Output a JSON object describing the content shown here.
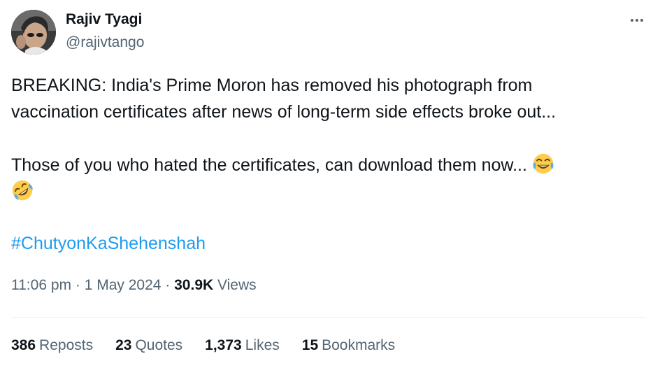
{
  "author": {
    "display_name": "Rajiv Tyagi",
    "handle": "@rajivtango"
  },
  "tweet": {
    "line1": "BREAKING: India's Prime Moron has removed his photograph from",
    "line2": "vaccination certificates after news of long-term side effects broke out...",
    "line3": "Those of you who hated the certificates, can download them now...",
    "emoji1": "face-with-tears-of-joy",
    "emoji2": "rolling-on-the-floor-laughing",
    "hashtag": "#ChutyonKaShehenshah"
  },
  "meta": {
    "time": "11:06 pm",
    "separator": "·",
    "date": "1 May 2024",
    "views_count": "30.9K",
    "views_label": "Views"
  },
  "stats": {
    "reposts_count": "386",
    "reposts_label": "Reposts",
    "quotes_count": "23",
    "quotes_label": "Quotes",
    "likes_count": "1,373",
    "likes_label": "Likes",
    "bookmarks_count": "15",
    "bookmarks_label": "Bookmarks"
  },
  "colors": {
    "text": "#0f1419",
    "secondary": "#536471",
    "link": "#1d9bf0",
    "divider": "#eff3f4"
  }
}
